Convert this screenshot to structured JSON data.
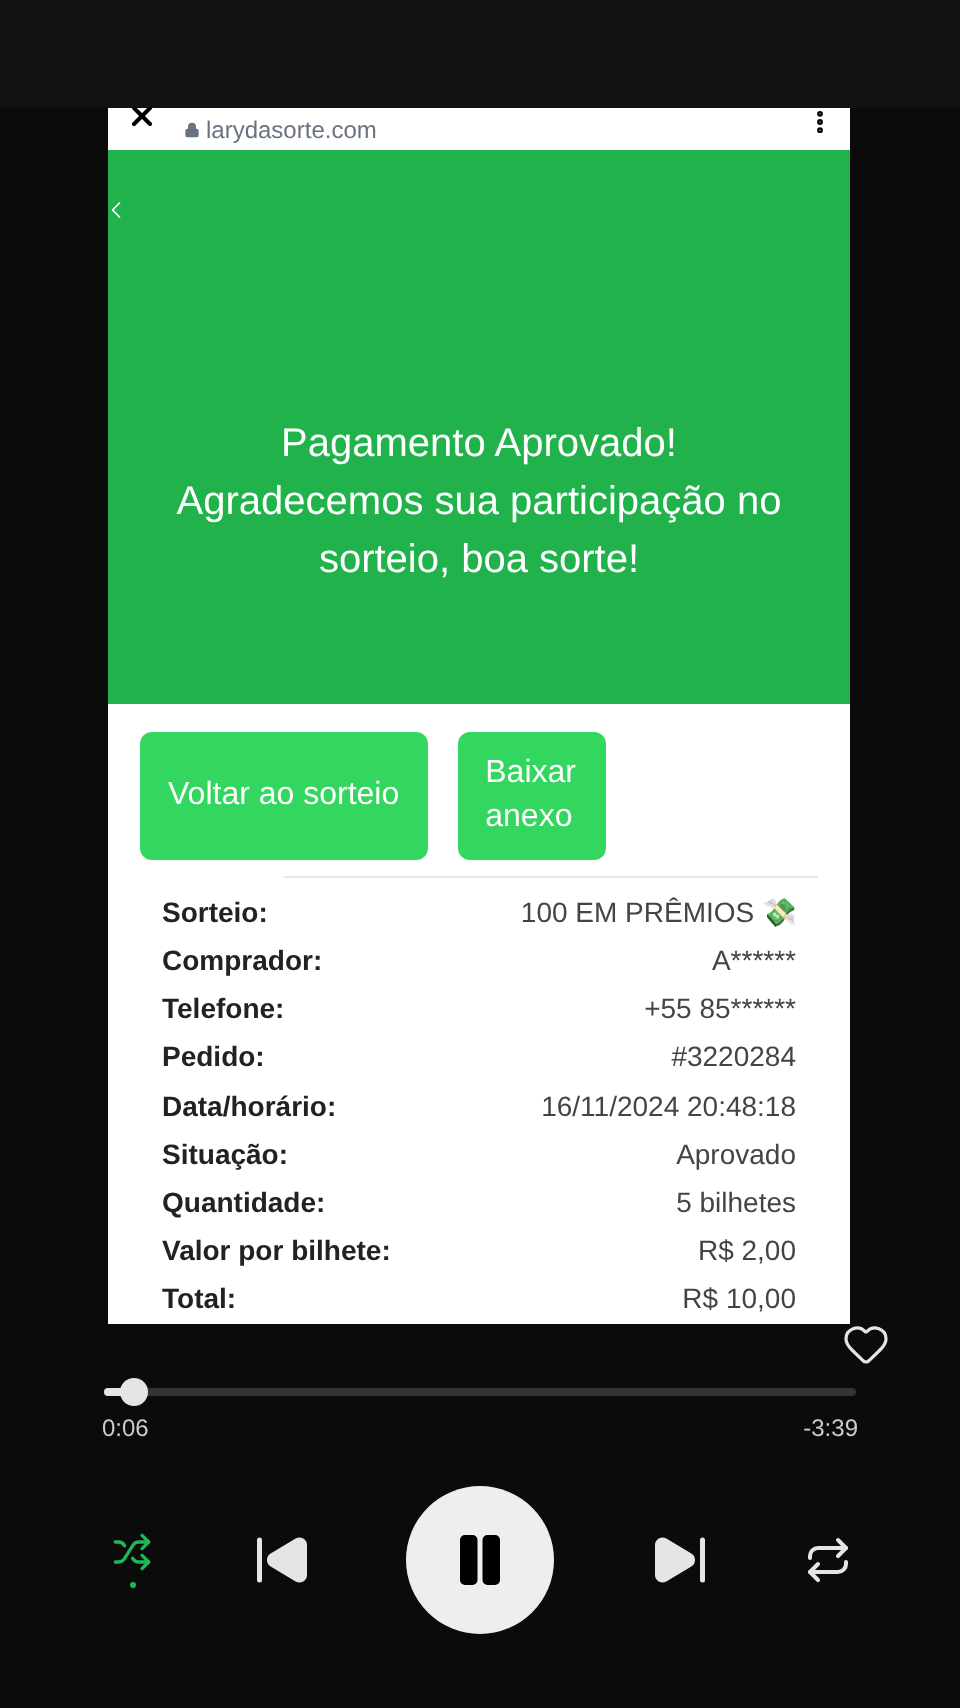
{
  "browser": {
    "url": "larydasorte.com"
  },
  "hero": {
    "message": "Pagamento Aprovado!\nAgradecemos sua participação no\nsorteio, boa sorte!"
  },
  "buttons": [
    {
      "label": "Voltar ao sorteio"
    },
    {
      "label": "Baixar anexo"
    }
  ],
  "details": [
    {
      "label": "Sorteio:",
      "value": "100 EM PRÊMIOS 💸"
    },
    {
      "label": "Comprador:",
      "value": "A******"
    },
    {
      "label": "Telefone:",
      "value": "+55 85******"
    },
    {
      "label": "Pedido:",
      "value": "#3220284"
    },
    {
      "label": "Data/horário:",
      "value": "16/11/2024 20:48:18"
    },
    {
      "label": "Situação:",
      "value": "Aprovado"
    },
    {
      "label": "Quantidade:",
      "value": "5 bilhetes"
    },
    {
      "label": "Valor por bilhete:",
      "value": "R$ 2,00"
    },
    {
      "label": "Total:",
      "value": "R$ 10,00"
    }
  ],
  "player": {
    "liked": false,
    "level": 0.04,
    "elapsed": "0:06",
    "remaining": "-3:39",
    "shuffle": true,
    "playing": true
  }
}
